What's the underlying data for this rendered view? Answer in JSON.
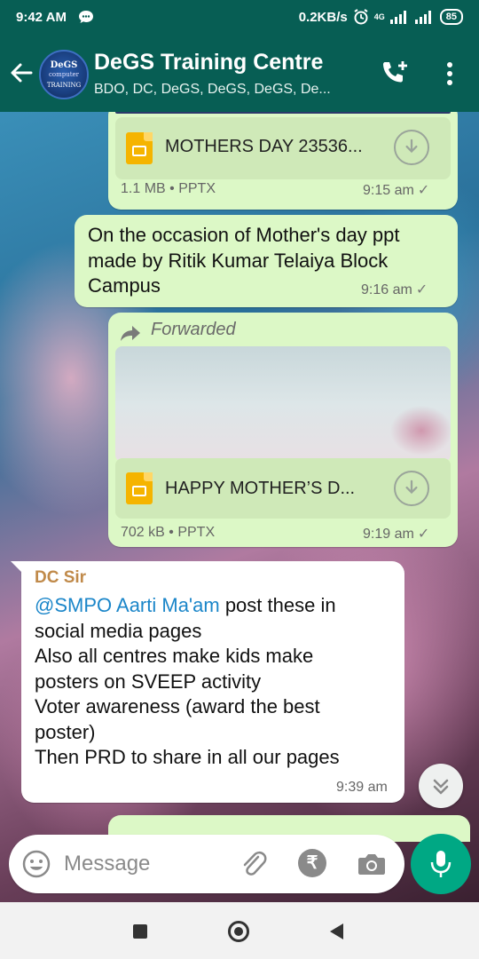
{
  "status_bar": {
    "time": "9:42 AM",
    "network_speed": "0.2KB/s",
    "network_type": "4G",
    "battery": "85",
    "icons": [
      "message-notification-icon",
      "alarm-icon",
      "signal-icon",
      "signal-icon",
      "battery-icon"
    ]
  },
  "app_bar": {
    "title": "DeGS Training Centre",
    "subtitle": "BDO, DC, DeGS, DeGS, DeGS, De...",
    "avatar_text": [
      "DeGS",
      "computer",
      "TRAINING"
    ],
    "icons": [
      "back-arrow-icon",
      "add-call-icon",
      "more-options-icon"
    ]
  },
  "messages": [
    {
      "type": "file",
      "direction": "outgoing",
      "file_name": "MOTHERS DAY 23536...",
      "size": "1.1 MB",
      "file_type": "PPTX",
      "time": "9:15 am",
      "status": "sent"
    },
    {
      "type": "text",
      "direction": "outgoing",
      "text_lines": [
        "On the occasion of Mother's day ppt",
        "made by Ritik Kumar Telaiya Block",
        "Campus"
      ],
      "time": "9:16 am",
      "status": "sent"
    },
    {
      "type": "file",
      "direction": "outgoing",
      "forwarded_label": "Forwarded",
      "file_name": "HAPPY MOTHER’S D...",
      "size": "702 kB",
      "file_type": "PPTX",
      "time": "9:19 am",
      "status": "sent"
    },
    {
      "type": "text",
      "direction": "incoming",
      "sender": "DC Sir",
      "mention": "@SMPO Aarti Ma'am",
      "first_line_rest": " post these in",
      "text_lines": [
        "social media pages",
        "Also all centres make kids make",
        "posters on SVEEP activity",
        "Voter awareness (award the best",
        "poster)",
        "Then PRD to share in all our pages"
      ],
      "time": "9:39 am"
    }
  ],
  "meta_separator": "•",
  "tick_glyph": "✓",
  "input": {
    "placeholder": "Message",
    "rupee_symbol": "₹"
  },
  "colors": {
    "header": "#075e54",
    "outgoing_bubble": "#dcf8c6",
    "incoming_bubble": "#ffffff",
    "mention": "#1b86c9",
    "sender": "#c08a4a",
    "mic_button": "#00a884"
  }
}
